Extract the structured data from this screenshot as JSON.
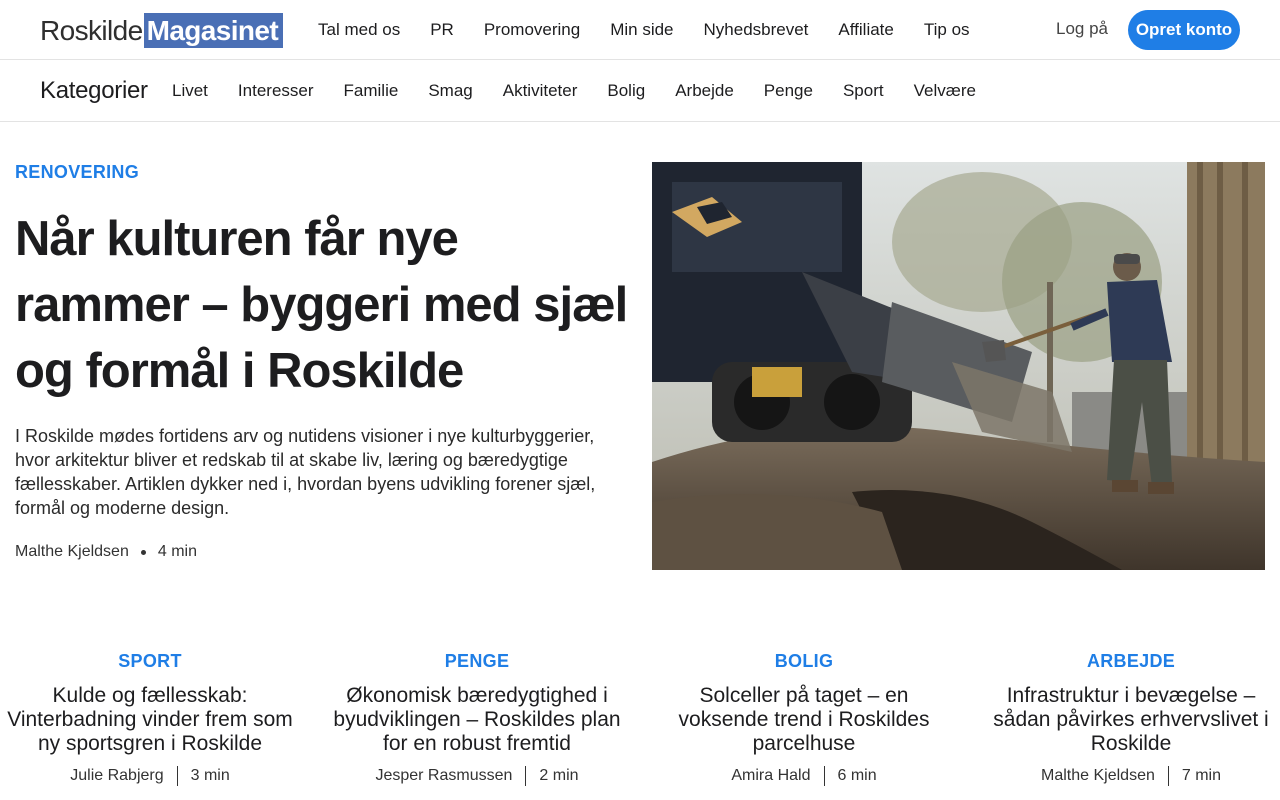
{
  "header": {
    "logo_plain": "Roskilde",
    "logo_box": "Magasinet",
    "nav": [
      "Tal med os",
      "PR",
      "Promovering",
      "Min side",
      "Nyhedsbrevet",
      "Affiliate",
      "Tip os"
    ],
    "login_label": "Log på",
    "signup_label": "Opret konto"
  },
  "categories": {
    "title": "Kategorier",
    "items": [
      "Livet",
      "Interesser",
      "Familie",
      "Smag",
      "Aktiviteter",
      "Bolig",
      "Arbejde",
      "Penge",
      "Sport",
      "Velvære"
    ]
  },
  "hero": {
    "kicker": "RENOVERING",
    "title": "Når kulturen får nye rammer – byggeri med sjæl og formål i Roskilde",
    "description": "I Roskilde mødes fortidens arv og nutidens visioner i nye kulturbyggerier, hvor arkitektur bliver et redskab til at skabe liv, læring og bæredygtige fællesskaber. Artiklen dykker ned i, hvordan byens udvikling forener sjæl, formål og moderne design.",
    "author": "Malthe Kjeldsen",
    "read_time": "4 min"
  },
  "cards": [
    {
      "kicker": "SPORT",
      "title": "Kulde og fællesskab: Vinterbadning vinder frem som ny sportsgren i Roskilde",
      "author": "Julie Rabjerg",
      "read_time": "3 min"
    },
    {
      "kicker": "PENGE",
      "title": "Økonomisk bæredygtighed i byudviklingen – Roskildes plan for en robust fremtid",
      "author": "Jesper Rasmussen",
      "read_time": "2 min"
    },
    {
      "kicker": "BOLIG",
      "title": "Solceller på taget – en voksende trend i Roskildes parcelhuse",
      "author": "Amira Hald",
      "read_time": "6 min"
    },
    {
      "kicker": "ARBEJDE",
      "title": "Infrastruktur i bevægelse – sådan påvirkes erhvervslivet i Roskilde",
      "author": "Malthe Kjeldsen",
      "read_time": "7 min"
    }
  ],
  "colors": {
    "accent": "#1f7ee6",
    "logo_box": "#4a6fb5",
    "text": "#1d1d1f"
  }
}
